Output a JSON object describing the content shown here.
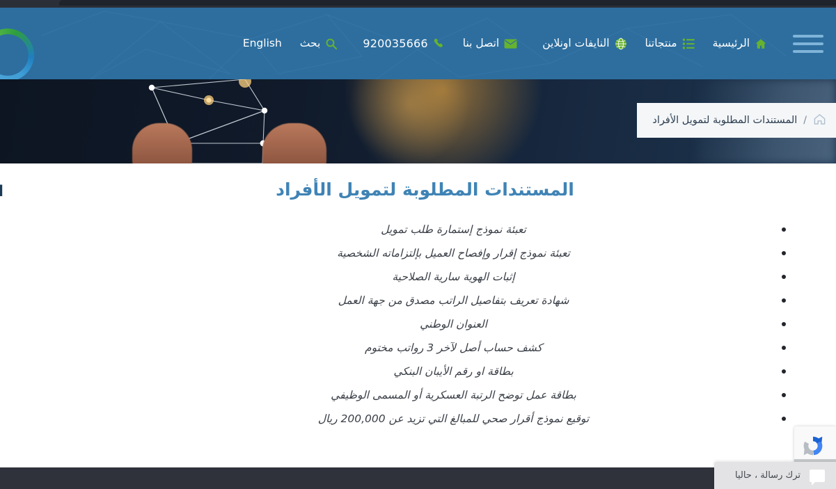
{
  "nav": {
    "hamburger_icon": "hamburger-menu-icon",
    "logo_icon": "company-logo-ring",
    "items": [
      {
        "label": "الرئيسية",
        "icon": "home-icon"
      },
      {
        "label": "منتجاتنا",
        "icon": "list-icon"
      },
      {
        "label": "النايفات اونلاين",
        "icon": "globe-icon"
      }
    ],
    "contact": {
      "label": "اتصل بنا",
      "icon": "envelope-icon"
    },
    "phone": {
      "number": "920035666",
      "icon": "phone-icon"
    },
    "search": {
      "label": "بحث",
      "icon": "search-icon"
    },
    "language": {
      "label": "English"
    }
  },
  "breadcrumb": {
    "home_icon": "home-icon",
    "separator": "/",
    "current": "المستندات المطلوبة لتمويل الأفراد"
  },
  "main": {
    "title": "المستندات المطلوبة لتمويل الأفراد",
    "left_clip_text": "ا",
    "documents": [
      "تعبئة نموذج إستمارة طلب تمويل",
      "تعبئة نموذج إقرار وإفصاح العميل بإلتزاماته الشخصية",
      "إثبات الهوية سارية الصلاحية",
      "شهادة تعريف بتفاصيل الراتب مصدق من جهة العمل",
      "العنوان الوطني",
      "كشف حساب أصل لآخر 3 رواتب مختوم",
      "بطاقة او رقم الأيبان البنكي",
      "بطاقة عمل توضح الرتبة العسكرية أو المسمى الوظيفي",
      "توقيع نموذج أقرار صحي للمبالغ التي تزيد عن 200,000 ريال"
    ]
  },
  "chat": {
    "label": "ترك رسالة ، حاليا",
    "icon": "chat-bubble-icon"
  },
  "recaptcha": {
    "icon": "recaptcha-badge-icon"
  },
  "colors": {
    "nav_bg": "#2d6e9f",
    "accent_green": "#66b32e",
    "title_blue": "#3f83b5",
    "breadcrumb_bg": "#f4f6f8",
    "footer_bg": "#2f323b",
    "chat_bg": "#e3e3e5"
  }
}
